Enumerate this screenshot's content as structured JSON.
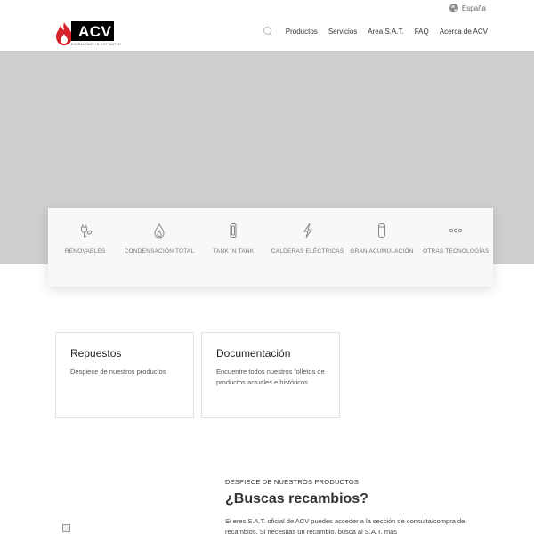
{
  "locale": {
    "label": "España"
  },
  "header": {
    "logo_text": "ACV",
    "logo_tagline": "EXCELLENCE IN HOT WATER",
    "nav": [
      {
        "label": "Productos"
      },
      {
        "label": "Servicios"
      },
      {
        "label": "Area S.A.T."
      },
      {
        "label": "FAQ"
      },
      {
        "label": "Acerca de ACV"
      }
    ]
  },
  "categories": [
    {
      "label": "RENOVABLES",
      "icon": "plug-leaf-icon"
    },
    {
      "label": "CONDENSACIÓN TOTAL",
      "icon": "flame-drop-icon"
    },
    {
      "label": "TANK IN TANK",
      "icon": "tank-icon"
    },
    {
      "label": "CALDERAS ELÉCTRICAS",
      "icon": "lightning-icon"
    },
    {
      "label": "GRAN ACUMULACIÓN",
      "icon": "cylinder-icon"
    },
    {
      "label": "OTRAS TECNOLOGÍAS",
      "icon": "dots-icon"
    }
  ],
  "cards": [
    {
      "title": "Repuestos",
      "text": "Despiece de nuestros productos"
    },
    {
      "title": "Documentación",
      "text": "Encuentre todos nuestros folletos de productos actuales e históricos"
    }
  ],
  "section": {
    "eyebrow": "DESPIECE DE NUESTROS PRODUCTOS",
    "title": "¿Buscas recambios?",
    "body": "Si eres S.A.T. oficial de ACV puedes acceder a la sección de consulta/compra de recambios. Si necesitas un recambio, busca al S.A.T. más"
  },
  "colors": {
    "hero_bg": "#cecece",
    "logo_red": "#d6202a",
    "logo_black": "#000000"
  }
}
